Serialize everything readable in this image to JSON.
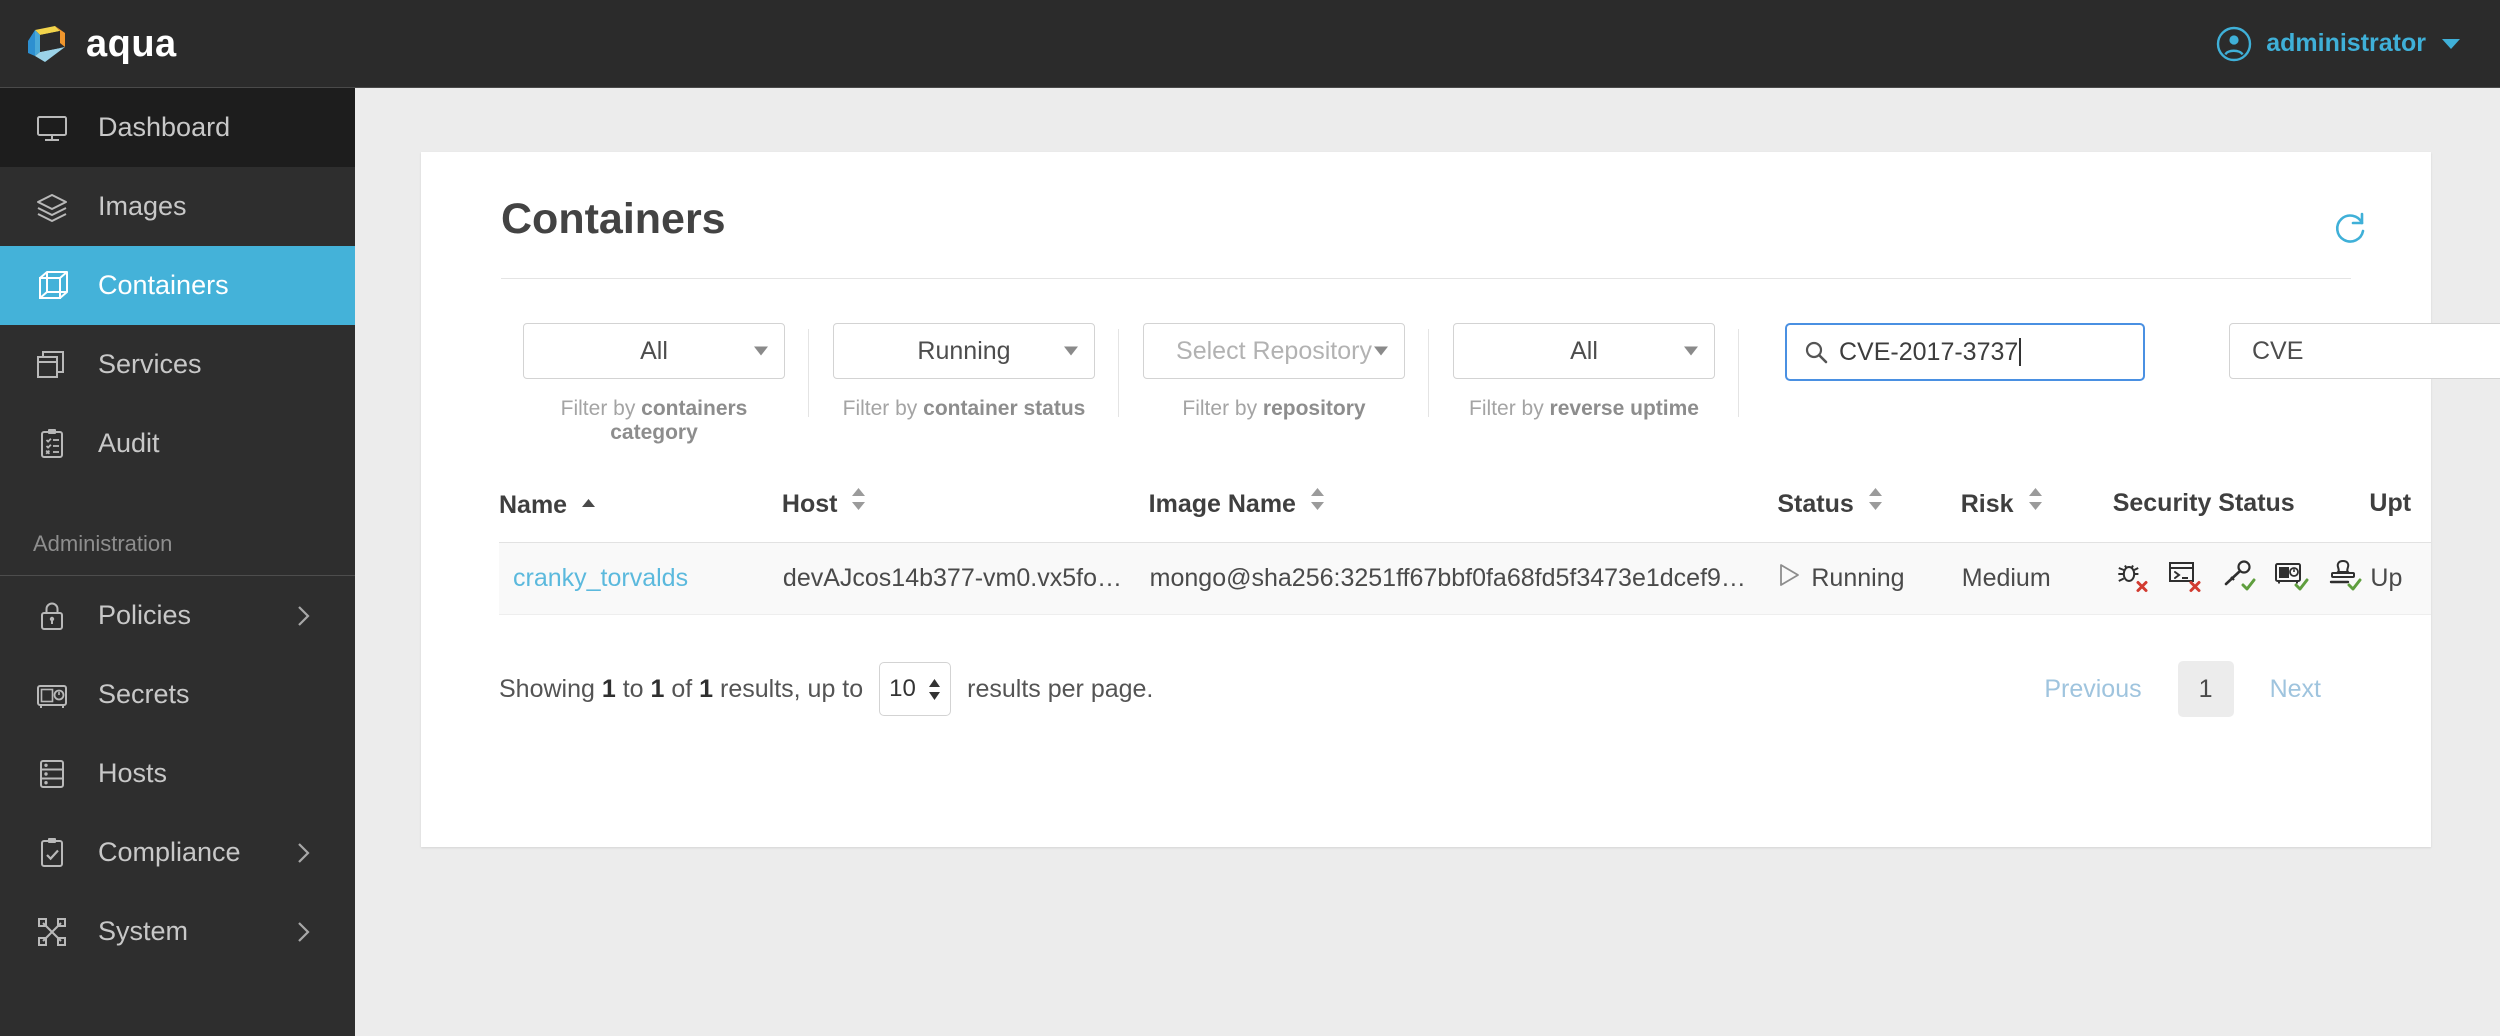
{
  "app": {
    "brand_name": "aqua",
    "logo_icon": "aqua-cube-logo",
    "accent_color": "#44b2d9",
    "topbar_bg": "#2b2b2b"
  },
  "topbar": {
    "user_icon": "user-circle-icon",
    "user_name": "administrator",
    "caret_icon": "caret-down-icon"
  },
  "sidebar": {
    "items": [
      {
        "label": "Dashboard",
        "icon": "monitor-icon",
        "state": "hover",
        "chevron": false
      },
      {
        "label": "Images",
        "icon": "layers-icon",
        "state": "normal",
        "chevron": false
      },
      {
        "label": "Containers",
        "icon": "cube-icon",
        "state": "active",
        "chevron": false
      },
      {
        "label": "Services",
        "icon": "windows-icon",
        "state": "normal",
        "chevron": false
      },
      {
        "label": "Audit",
        "icon": "clipboard-list-icon",
        "state": "normal",
        "chevron": false
      }
    ],
    "section_label": "Administration",
    "admin_items": [
      {
        "label": "Policies",
        "icon": "lock-icon",
        "chevron": true
      },
      {
        "label": "Secrets",
        "icon": "safe-icon",
        "chevron": false
      },
      {
        "label": "Hosts",
        "icon": "server-icon",
        "chevron": false
      },
      {
        "label": "Compliance",
        "icon": "clipboard-check-icon",
        "chevron": true
      },
      {
        "label": "System",
        "icon": "nodes-icon",
        "chevron": true
      }
    ]
  },
  "page": {
    "title": "Containers",
    "refresh_icon": "refresh-icon"
  },
  "filters": [
    {
      "name": "containers-category",
      "value": "All",
      "is_placeholder": false,
      "caption_prefix": "Filter by ",
      "caption_bold": "containers category"
    },
    {
      "name": "container-status",
      "value": "Running",
      "is_placeholder": false,
      "caption_prefix": "Filter by ",
      "caption_bold": "container status"
    },
    {
      "name": "repository",
      "value": "Select Repository",
      "is_placeholder": true,
      "caption_prefix": "Filter by ",
      "caption_bold": "repository"
    },
    {
      "name": "reverse-uptime",
      "value": "All",
      "is_placeholder": false,
      "caption_prefix": "Filter by ",
      "caption_bold": "reverse uptime"
    }
  ],
  "search": {
    "icon": "search-icon",
    "value": "CVE-2017-3737",
    "placeholder": "",
    "focused": true,
    "focus_color": "#4a90e2"
  },
  "search_scope": {
    "value": "CVE",
    "arrow_icon": "caret-down-icon"
  },
  "table": {
    "columns": [
      {
        "label": "Name",
        "sort": "asc"
      },
      {
        "label": "Host",
        "sort": "both"
      },
      {
        "label": "Image Name",
        "sort": "both"
      },
      {
        "label": "Status",
        "sort": "both"
      },
      {
        "label": "Risk",
        "sort": "both"
      },
      {
        "label": "Security Status",
        "sort": "none"
      },
      {
        "label": "Upt",
        "sort": "none"
      }
    ],
    "rows": [
      {
        "name": "cranky_torvalds",
        "host": "devAJcos14b377-vm0.vx5fo…",
        "image_name": "mongo@sha256:3251ff67bbf0fa68fd5f3473e1dcef9…",
        "status": "Running",
        "status_icon": "play-outline-icon",
        "risk": "Medium",
        "security_status": [
          {
            "icon": "bug-icon",
            "badge": "x",
            "badge_color": "#d23b30"
          },
          {
            "icon": "terminal-icon",
            "badge": "x",
            "badge_color": "#d23b30"
          },
          {
            "icon": "key-icon",
            "badge": "check",
            "badge_color": "#5f9e3e"
          },
          {
            "icon": "safe-icon",
            "badge": "check",
            "badge_color": "#5f9e3e"
          },
          {
            "icon": "stamp-icon",
            "badge": "check",
            "badge_color": "#5f9e3e"
          }
        ],
        "uptime": "Up"
      }
    ]
  },
  "pagination": {
    "showing_prefix": "Showing ",
    "from": "1",
    "to_word": " to ",
    "to": "1",
    "of_word": " of ",
    "total": "1",
    "results_word": " results, up to ",
    "per_page": "10",
    "per_page_suffix": "results per page.",
    "previous_label": "Previous",
    "current_page": "1",
    "next_label": "Next"
  }
}
